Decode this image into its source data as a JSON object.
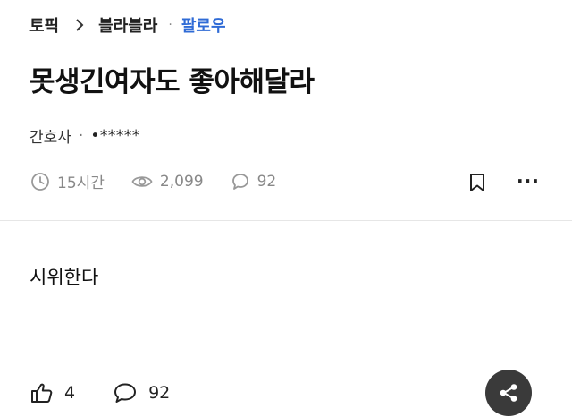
{
  "breadcrumb": {
    "topic": "토픽",
    "board": "블라블라",
    "separator": "·",
    "follow": "팔로우",
    "follow_color": "#2f6bd6"
  },
  "post": {
    "title": "못생긴여자도 좋아해달라",
    "author": "간호사",
    "author_separator": "·",
    "company": "•*****",
    "body": "시위한다"
  },
  "stats": {
    "time": "15시간",
    "views": "2,099",
    "comments": "92"
  },
  "actions": {
    "bookmark_icon": "bookmark-icon",
    "more_label": "···"
  },
  "bottom_bar": {
    "likes": "4",
    "comments": "92",
    "share_icon": "share-icon"
  }
}
